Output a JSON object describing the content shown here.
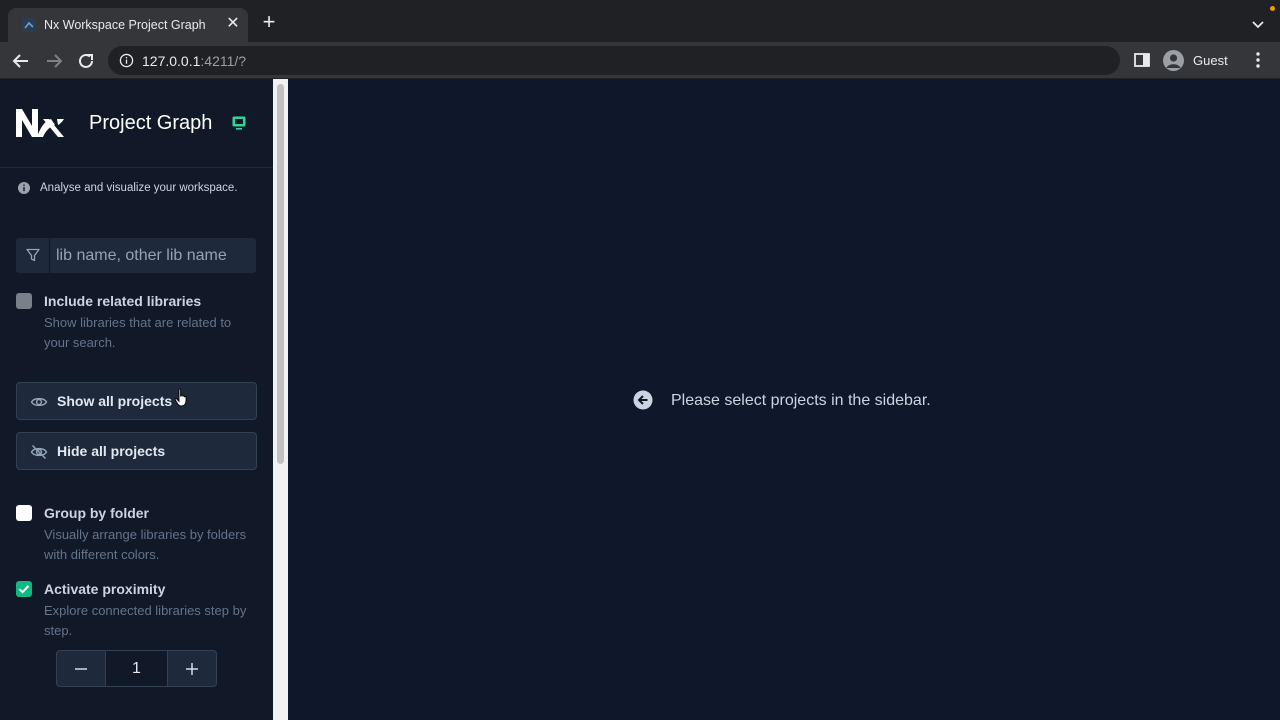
{
  "browser": {
    "tab_title": "Nx Workspace Project Graph",
    "url_host": "127.0.0.1",
    "url_rest": ":4211/?",
    "profile_name": "Guest"
  },
  "app": {
    "title": "Project Graph",
    "info_text": "Analyse and visualize your workspace.",
    "filter_placeholder": "lib name, other lib name",
    "include_related": {
      "title": "Include related libraries",
      "description": "Show libraries that are related to your search.",
      "checked": false
    },
    "show_all_label": "Show all projects",
    "hide_all_label": "Hide all projects",
    "group_by_folder": {
      "title": "Group by folder",
      "description": "Visually arrange libraries by folders with different colors.",
      "checked": false
    },
    "activate_proximity": {
      "title": "Activate proximity",
      "description": "Explore connected libraries step by step.",
      "checked": true
    },
    "proximity_value": "1",
    "empty_message": "Please select projects in the sidebar."
  },
  "colors": {
    "sidebar_bg": "#111827",
    "main_bg": "#0f172a",
    "accent_green": "#10b981"
  }
}
